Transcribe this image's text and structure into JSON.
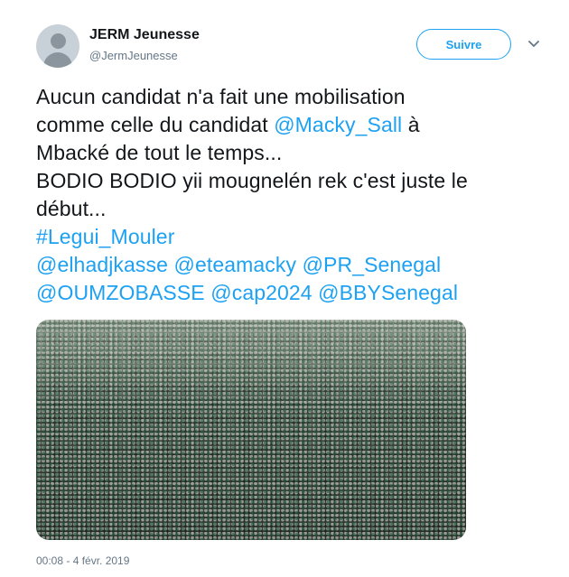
{
  "author": {
    "name": "JERM Jeunesse",
    "handle": "@JermJeunesse"
  },
  "follow_label": "Suivre",
  "tweet": {
    "line1": "Aucun candidat n'a fait une mobilisation",
    "line2_prefix": "comme celle du candidat ",
    "mention_macky": "@Macky_Sall",
    "line2_suffix": " à",
    "line3": "Mbacké de tout le temps...",
    "line4": "BODIO BODIO yii mougnelén rek c'est juste le",
    "line5": "début...",
    "hashtag": "#Legui_Mouler",
    "mention_elhadj": "@elhadjkasse",
    "mention_eteamacky": "@eteamacky",
    "mention_pr": "@PR_Senegal",
    "mention_oumzo": "@OUMZOBASSE",
    "mention_cap": "@cap2024",
    "mention_bby": "@BBYSenegal"
  },
  "timestamp": "00:08 - 4 févr. 2019",
  "colors": {
    "link": "#1da1f2",
    "text": "#14171a",
    "muted": "#657786"
  },
  "icons": {
    "avatar": "default-profile-icon",
    "menu": "chevron-down-icon"
  }
}
